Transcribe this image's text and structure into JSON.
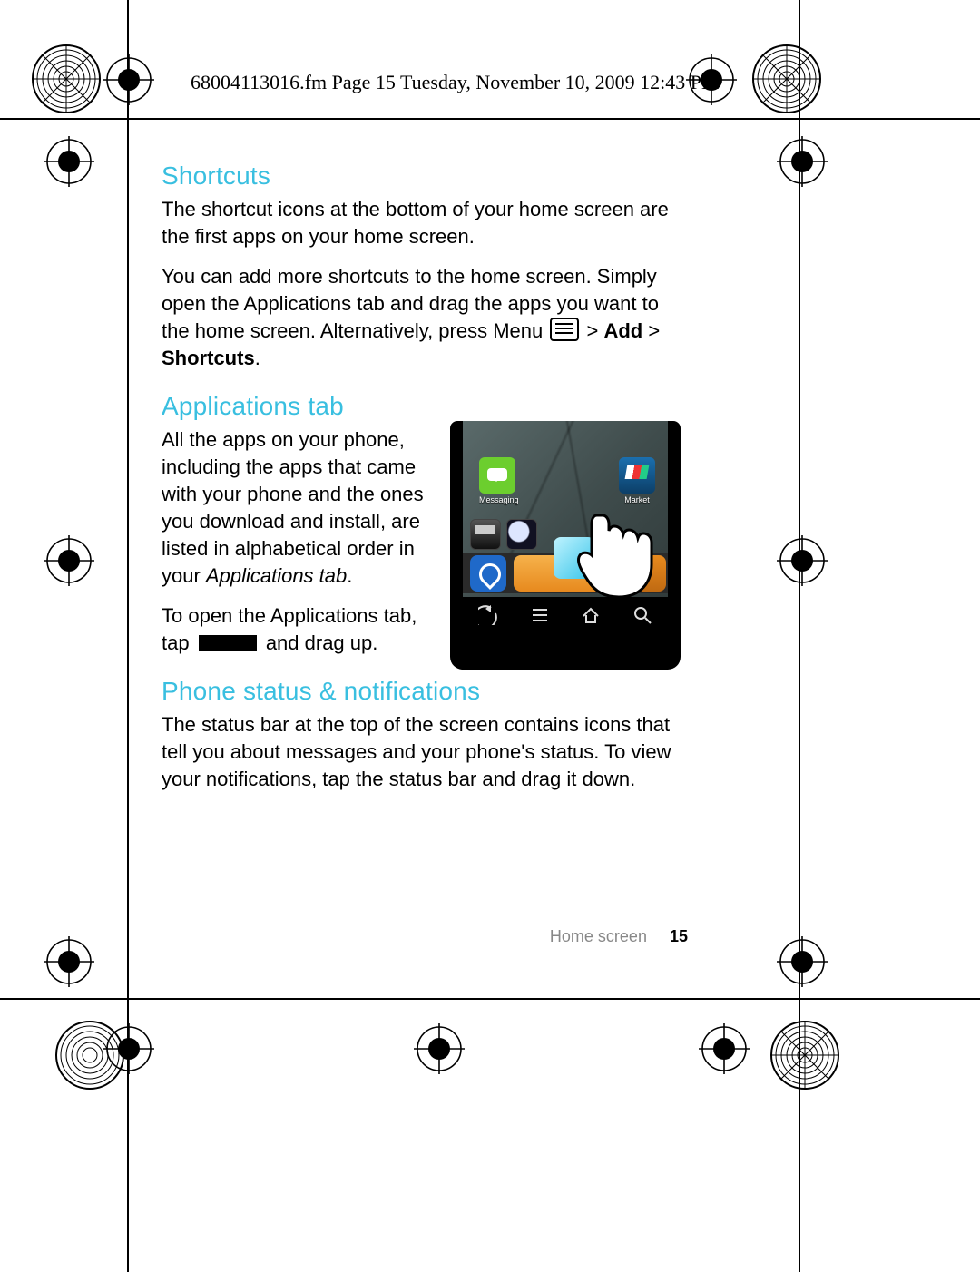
{
  "meta_header": "68004113016.fm  Page 15  Tuesday, November 10, 2009  12:43 PM",
  "sections": {
    "shortcuts": {
      "title": "Shortcuts",
      "p1": "The shortcut icons at the bottom of your home screen are the first apps on your home screen.",
      "p2a": "You can add more shortcuts to the home screen. Simply open the Applications tab and drag the apps you want to the home screen. Alternatively, press Menu ",
      "p2b": " > ",
      "add": "Add",
      "p2c": " > ",
      "shortcuts_word": "Shortcuts",
      "p2d": "."
    },
    "apps": {
      "title": "Applications tab",
      "p1a": "All the apps on your phone, including the apps that came with your phone and the ones you download and install, are listed in alphabetical order in your ",
      "p1b": "Applications tab",
      "p1c": ".",
      "p2a": "To open the Applications tab, tap ",
      "p2b": " and drag up."
    },
    "status": {
      "title": "Phone status & notifications",
      "p1": "The status bar at the top of the screen contains icons that tell you about messages and your phone's status. To view your notifications, tap the status bar and drag it down."
    }
  },
  "phone": {
    "apps": {
      "messaging": "Messaging",
      "market": "Market"
    }
  },
  "footer": {
    "section": "Home screen",
    "page": "15"
  }
}
